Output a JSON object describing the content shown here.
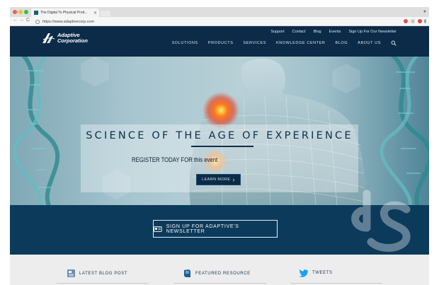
{
  "browser": {
    "tab_title": "The Digital To Physical Prod...",
    "tab_close": "✕",
    "url": "https://www.adaptivecorp.com",
    "back": "←",
    "forward": "→",
    "reload": "C"
  },
  "site": {
    "logo_line1": "Adaptive",
    "logo_line2": "Corporation",
    "utility_nav": [
      "Support",
      "Contact",
      "Blog",
      "Events",
      "Sign Up For Our Newsletter"
    ],
    "main_nav": [
      "SOLUTIONS",
      "PRODUCTS",
      "SERVICES",
      "KNOWLEDGE CENTER",
      "BLOG",
      "ABOUT US"
    ]
  },
  "hero": {
    "headline": "SCIENCE OF THE AGE OF EXPERIENCE",
    "subheadline": "REGISTER TODAY FOR this event",
    "button_label": "LEARN MORE",
    "button_arrow": "›"
  },
  "newsletter": {
    "button_label": "SIGN UP FOR ADAPTIVE'S NEWSLETTER"
  },
  "footer": {
    "items": [
      "LATEST BLOG POST",
      "FEATURED RESOURCE",
      "TWEETS"
    ]
  },
  "colors": {
    "brand_navy": "#0c2b48",
    "band_blue": "#0c3a5a",
    "heat_red": "#e83a1e",
    "twitter_blue": "#1da1f2"
  }
}
